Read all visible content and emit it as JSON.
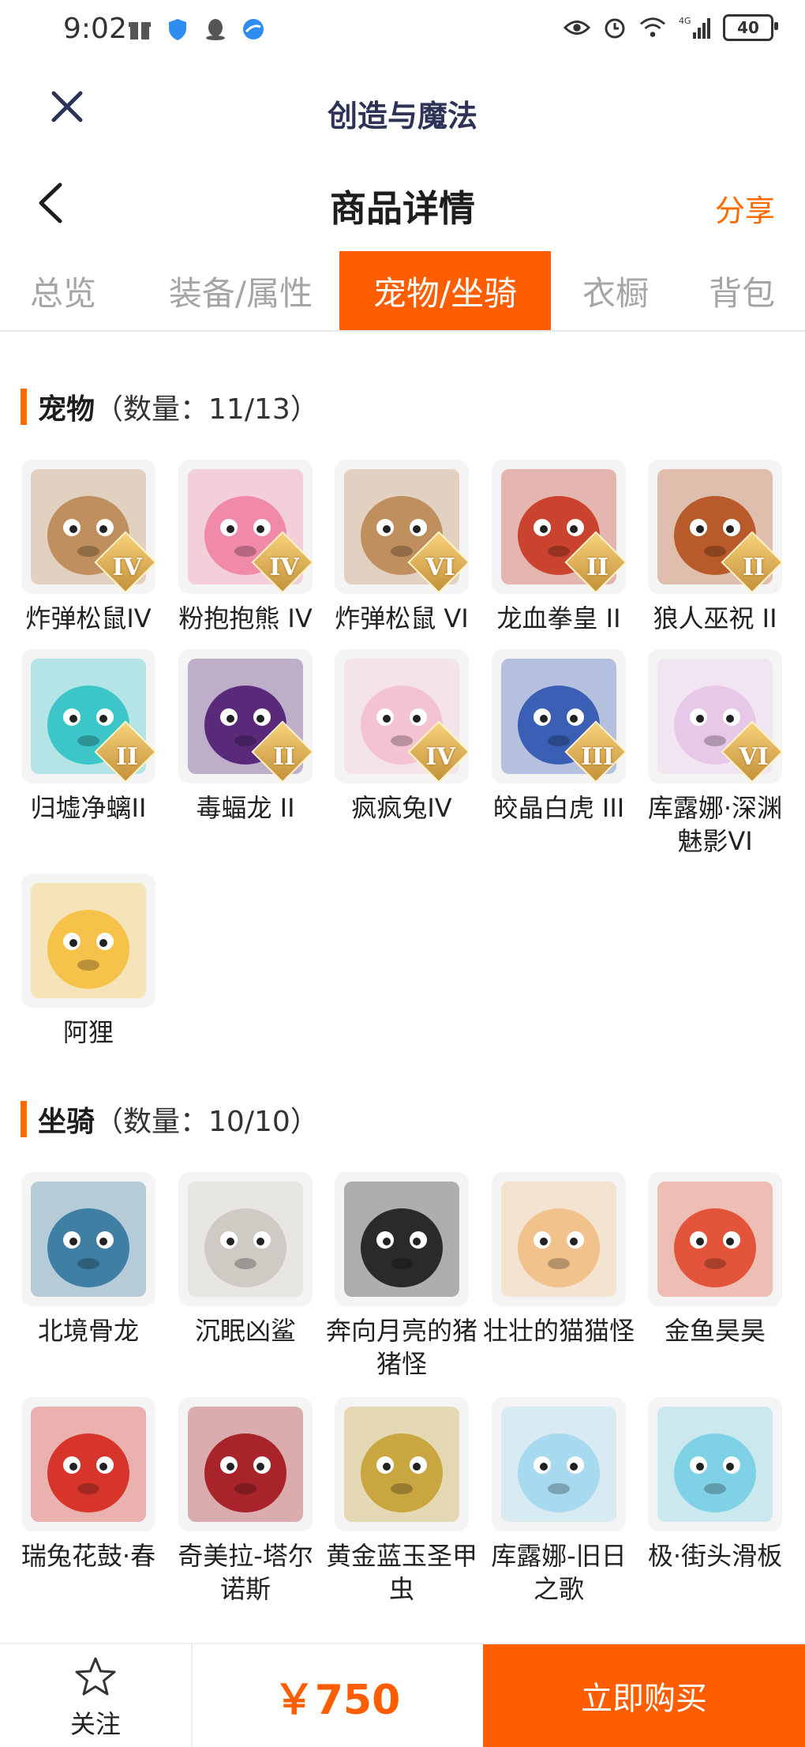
{
  "status": {
    "time": "9:02",
    "battery": "40",
    "network": "4G"
  },
  "app": {
    "title": "创造与魔法"
  },
  "header": {
    "title": "商品详情",
    "share": "分享"
  },
  "tabs": [
    {
      "label": "总览",
      "active": false
    },
    {
      "label": "装备/属性",
      "active": false
    },
    {
      "label": "宠物/坐骑",
      "active": true
    },
    {
      "label": "衣橱",
      "active": false
    },
    {
      "label": "背包",
      "active": false
    }
  ],
  "pets": {
    "title": "宠物",
    "count": "（数量：11/13）",
    "items": [
      {
        "name": "炸弹松鼠IV",
        "badge": "IV",
        "color": "#c08f5e"
      },
      {
        "name": "粉抱抱熊 IV",
        "badge": "IV",
        "color": "#f08aa8"
      },
      {
        "name": "炸弹松鼠 VI",
        "badge": "VI",
        "color": "#c08f5e"
      },
      {
        "name": "龙血拳皇 II",
        "badge": "II",
        "color": "#c9432e"
      },
      {
        "name": "狼人巫祝 II",
        "badge": "II",
        "color": "#b85a2a"
      },
      {
        "name": "归墟净螭II",
        "badge": "II",
        "color": "#3cc6c9"
      },
      {
        "name": "毒蝠龙 II",
        "badge": "II",
        "color": "#5a2a7a"
      },
      {
        "name": "疯疯兔IV",
        "badge": "IV",
        "color": "#f4c3d2"
      },
      {
        "name": "皎晶白虎 III",
        "badge": "III",
        "color": "#3b5fb5"
      },
      {
        "name": "库露娜·深渊魅影VI",
        "badge": "VI",
        "color": "#e7c8e8"
      },
      {
        "name": "阿狸",
        "badge": "",
        "color": "#f6c24a"
      }
    ]
  },
  "mounts": {
    "title": "坐骑",
    "count": "（数量：10/10）",
    "items": [
      {
        "name": "北境骨龙",
        "color": "#3f7fa3"
      },
      {
        "name": "沉眠凶鲨",
        "color": "#cfcac4"
      },
      {
        "name": "奔向月亮的猪猪怪",
        "color": "#2a2a2a"
      },
      {
        "name": "壮壮的猫猫怪",
        "color": "#f2c28c"
      },
      {
        "name": "金鱼昊昊",
        "color": "#e2553a"
      },
      {
        "name": "瑞兔花鼓·春",
        "color": "#d7352c"
      },
      {
        "name": "奇美拉-塔尔诺斯",
        "color": "#a8242a"
      },
      {
        "name": "黄金蓝玉圣甲虫",
        "color": "#c9a640"
      },
      {
        "name": "库露娜-旧日之歌",
        "color": "#a7d9ef"
      },
      {
        "name": "极·街头滑板",
        "color": "#7fd2e6"
      }
    ]
  },
  "bottom": {
    "follow": "关注",
    "price": "￥750",
    "buy": "立即购买"
  },
  "colors": {
    "accent": "#ff5e00"
  }
}
